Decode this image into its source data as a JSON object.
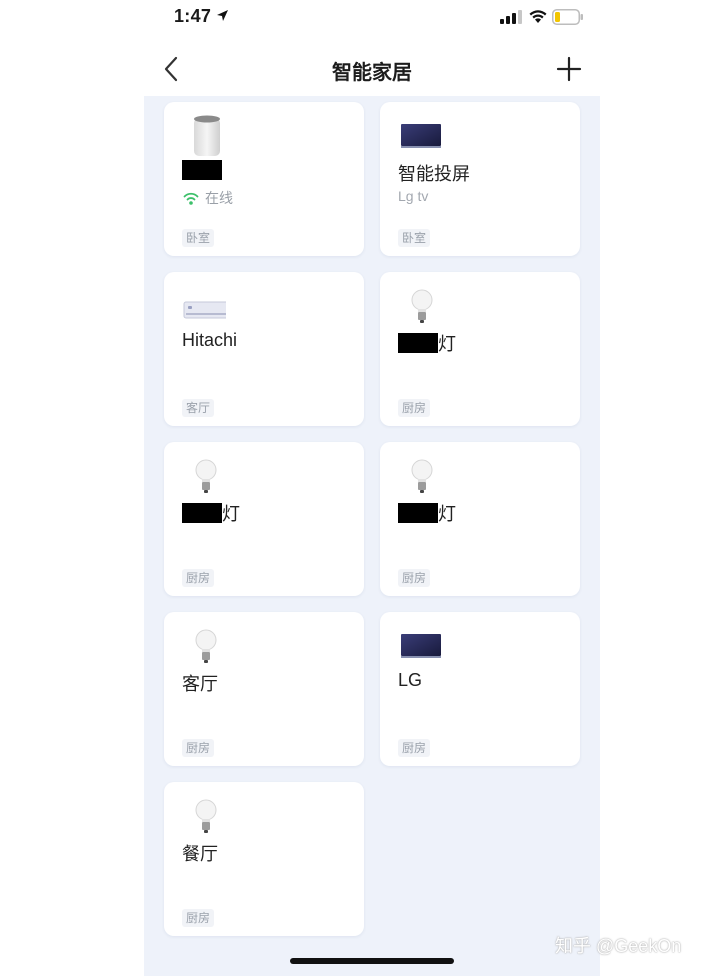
{
  "status_bar": {
    "time": "1:47"
  },
  "nav": {
    "title": "智能家居"
  },
  "devices": [
    {
      "name": "",
      "redacted": true,
      "name_suffix": "",
      "status": "在线",
      "room": "卧室",
      "icon": "smart-speaker-icon"
    },
    {
      "name": "智能投屏",
      "redacted": false,
      "name_suffix": "",
      "status": "Lg tv",
      "room": "卧室",
      "icon": "tv-icon"
    },
    {
      "name": "Hitachi",
      "redacted": false,
      "name_suffix": "",
      "status": "",
      "room": "客厅",
      "icon": "air-conditioner-icon"
    },
    {
      "name": "",
      "redacted": true,
      "name_suffix": "灯",
      "status": "",
      "room": "厨房",
      "icon": "light-bulb-icon"
    },
    {
      "name": "",
      "redacted": true,
      "name_suffix": "灯",
      "status": "",
      "room": "厨房",
      "icon": "light-bulb-icon"
    },
    {
      "name": "",
      "redacted": true,
      "name_suffix": "灯",
      "status": "",
      "room": "厨房",
      "icon": "light-bulb-icon"
    },
    {
      "name": "客厅",
      "redacted": false,
      "name_suffix": "",
      "status": "",
      "room": "厨房",
      "icon": "light-bulb-icon"
    },
    {
      "name": "LG",
      "redacted": false,
      "name_suffix": "",
      "status": "",
      "room": "厨房",
      "icon": "tv-icon"
    },
    {
      "name": "餐厅",
      "redacted": false,
      "name_suffix": "",
      "status": "",
      "room": "厨房",
      "icon": "light-bulb-icon"
    }
  ],
  "watermark": "知乎 @GeekOn",
  "colors": {
    "online": "#3cc06a",
    "background": "#eef2fa",
    "card": "#ffffff",
    "room_tag": "#f1f3f7"
  }
}
